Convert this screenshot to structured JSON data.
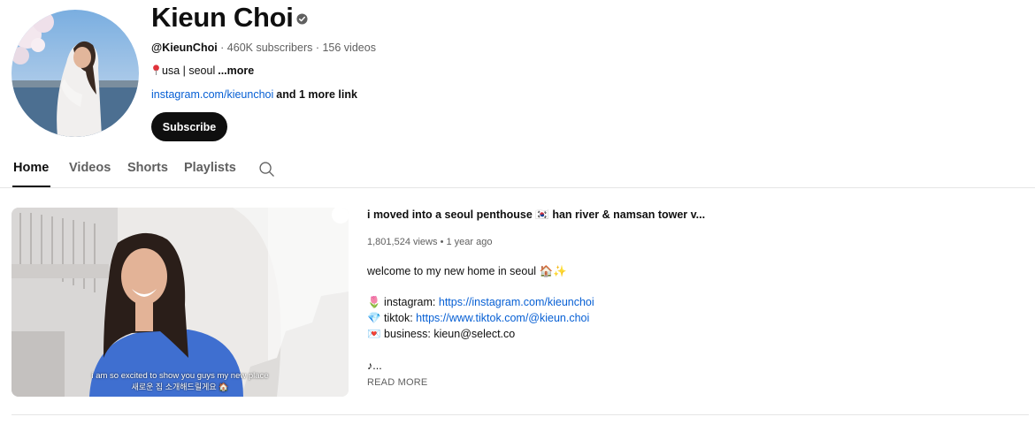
{
  "channel": {
    "name": "Kieun Choi",
    "handle": "@KieunChoi",
    "stats": " · 460K subscribers · 156 videos",
    "location": "usa | seoul",
    "more_label": "...more",
    "link": "instagram.com/kieunchoi",
    "more_links": "and 1 more link",
    "subscribe_label": "Subscribe"
  },
  "tabs": [
    {
      "label": "Home",
      "active": true
    },
    {
      "label": "Videos",
      "active": false
    },
    {
      "label": "Shorts",
      "active": false
    },
    {
      "label": "Playlists",
      "active": false
    }
  ],
  "featured_video": {
    "title": "i moved into a seoul penthouse 🇰🇷 han river & namsan tower v...",
    "views": "1,801,524 views",
    "separator": "•",
    "age": "1 year ago",
    "caption_line1": "i am so excited to show you guys my new place",
    "caption_line2": "새로운 집 소개해드릴게요 🏠",
    "description": {
      "intro": "welcome to my new home in seoul 🏠✨",
      "instagram_prefix": "🌷 instagram: ",
      "instagram_url": "https://instagram.com/kieunchoi",
      "tiktok_prefix": "💎 tiktok: ",
      "tiktok_url": "https://www.tiktok.com/@kieun.choi",
      "business": "💌 business: kieun@select.co",
      "music": "♪..."
    },
    "read_more_label": "READ MORE"
  },
  "colors": {
    "text_primary": "#0f0f0f",
    "text_secondary": "#606060",
    "link": "#065fd4",
    "subscribe_bg": "#0f0f0f",
    "divider": "#e5e5e5"
  },
  "icons": {
    "verified": "verified-badge-icon",
    "location": "pin-icon",
    "search": "search-icon"
  }
}
